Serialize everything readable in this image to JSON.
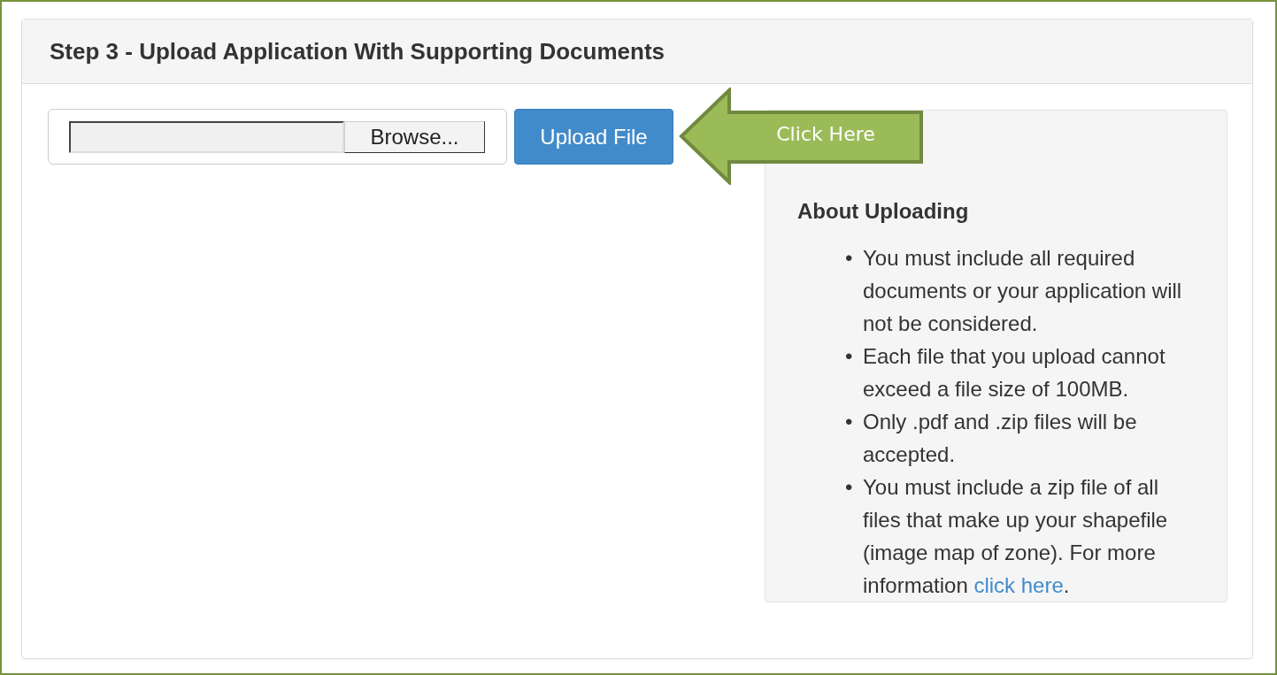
{
  "panel": {
    "title": "Step 3 - Upload Application With Supporting Documents"
  },
  "file_input": {
    "button": "Browse..."
  },
  "upload_button": "Upload File",
  "callout": {
    "label": "Click Here"
  },
  "info": {
    "heading": "About Uploading",
    "items": [
      {
        "bullet": "•",
        "text": "You must include all required documents or your application will not be considered."
      },
      {
        "bullet": "•",
        "text": "Each file that you upload cannot exceed a file size of 100MB."
      },
      {
        "bullet": "•",
        "text": "Only .pdf and .zip files will be accepted."
      },
      {
        "bullet": "•",
        "text": "You must include a zip file of all files that make up your shapefile (image map of zone). For more information ",
        "link": "click here",
        "after": "."
      }
    ]
  }
}
